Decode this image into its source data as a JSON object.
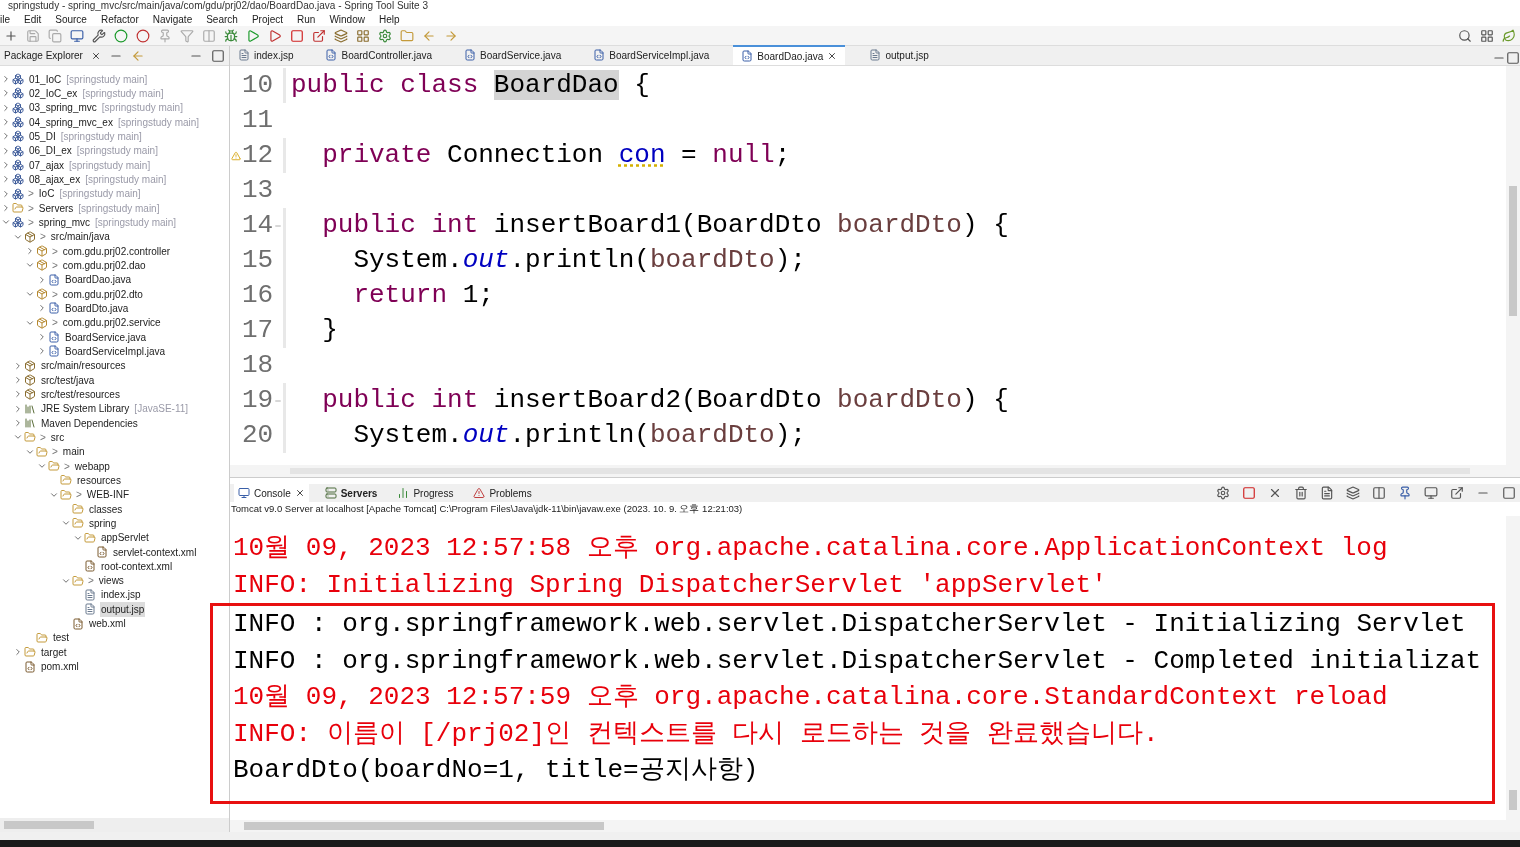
{
  "window": {
    "title": "springstudy - spring_mvc/src/main/java/com/gdu/prj02/dao/BoardDao.java - Spring Tool Suite 3"
  },
  "menu": [
    "ile",
    "Edit",
    "Source",
    "Refactor",
    "Navigate",
    "Search",
    "Project",
    "Run",
    "Window",
    "Help"
  ],
  "package_explorer": {
    "title": "Package Explorer",
    "tree": [
      {
        "label": "01_IoC",
        "decoration": "[springstudy main]",
        "kind": "project",
        "expanded": false,
        "selected": false
      },
      {
        "label": "02_IoC_ex",
        "decoration": "[springstudy main]",
        "kind": "project",
        "expanded": false,
        "selected": false
      },
      {
        "label": "03_spring_mvc",
        "decoration": "[springstudy main]",
        "kind": "project",
        "expanded": false,
        "selected": false
      },
      {
        "label": "04_spring_mvc_ex",
        "decoration": "[springstudy main]",
        "kind": "project",
        "expanded": false,
        "selected": false
      },
      {
        "label": "05_DI",
        "decoration": "[springstudy main]",
        "kind": "project",
        "expanded": false,
        "selected": false
      },
      {
        "label": "06_DI_ex",
        "decoration": "[springstudy main]",
        "kind": "project",
        "expanded": false,
        "selected": false
      },
      {
        "label": "07_ajax",
        "decoration": "[springstudy main]",
        "kind": "project",
        "expanded": false,
        "selected": false
      },
      {
        "label": "08_ajax_ex",
        "decoration": "[springstudy main]",
        "kind": "project",
        "expanded": false,
        "selected": false
      },
      {
        "prefix": ">",
        "label": "IoC",
        "decoration": "[springstudy main]",
        "kind": "project",
        "expanded": false,
        "selected": false
      },
      {
        "prefix": ">",
        "label": "Servers",
        "decoration": "[springstudy main]",
        "kind": "folder",
        "expanded": false,
        "selected": false
      },
      {
        "prefix": ">",
        "label": "spring_mvc",
        "decoration": "[springstudy main]",
        "kind": "project",
        "expanded": true,
        "selected": false,
        "children": [
          {
            "prefix": ">",
            "label": "src/main/java",
            "kind": "source",
            "expanded": true,
            "selected": false,
            "children": [
              {
                "prefix": ">",
                "label": "com.gdu.prj02.controller",
                "kind": "package",
                "expanded": false,
                "selected": false
              },
              {
                "prefix": ">",
                "label": "com.gdu.prj02.dao",
                "kind": "package",
                "expanded": true,
                "selected": false,
                "children": [
                  {
                    "label": "BoardDao.java",
                    "kind": "java",
                    "expanded": false,
                    "selected": false
                  }
                ]
              },
              {
                "prefix": ">",
                "label": "com.gdu.prj02.dto",
                "kind": "package",
                "expanded": true,
                "selected": false,
                "children": [
                  {
                    "label": "BoardDto.java",
                    "kind": "java",
                    "expanded": false,
                    "selected": false
                  }
                ]
              },
              {
                "prefix": ">",
                "label": "com.gdu.prj02.service",
                "kind": "package",
                "expanded": true,
                "selected": false,
                "children": [
                  {
                    "label": "BoardService.java",
                    "kind": "java",
                    "expanded": false,
                    "selected": false
                  },
                  {
                    "label": "BoardServiceImpl.java",
                    "kind": "java",
                    "expanded": false,
                    "selected": false
                  }
                ]
              }
            ]
          },
          {
            "label": "src/main/resources",
            "kind": "source",
            "expanded": false,
            "selected": false
          },
          {
            "label": "src/test/java",
            "kind": "source",
            "expanded": false,
            "selected": false
          },
          {
            "label": "src/test/resources",
            "kind": "source",
            "expanded": false,
            "selected": false
          },
          {
            "label": "JRE System Library",
            "decoration": "[JavaSE-11]",
            "kind": "library",
            "expanded": false,
            "selected": false
          },
          {
            "label": "Maven Dependencies",
            "kind": "library",
            "expanded": false,
            "selected": false
          },
          {
            "prefix": ">",
            "label": "src",
            "kind": "folder",
            "expanded": true,
            "selected": false,
            "children": [
              {
                "prefix": ">",
                "label": "main",
                "kind": "folder",
                "expanded": true,
                "selected": false,
                "children": [
                  {
                    "prefix": ">",
                    "label": "webapp",
                    "kind": "folder",
                    "expanded": true,
                    "selected": false,
                    "children": [
                      {
                        "label": "resources",
                        "kind": "folder",
                        "selected": false
                      },
                      {
                        "prefix": ">",
                        "label": "WEB-INF",
                        "kind": "folder",
                        "expanded": true,
                        "selected": false,
                        "children": [
                          {
                            "label": "classes",
                            "kind": "folder",
                            "selected": false
                          },
                          {
                            "label": "spring",
                            "kind": "folder",
                            "expanded": true,
                            "selected": false,
                            "children": [
                              {
                                "label": "appServlet",
                                "kind": "folder",
                                "expanded": true,
                                "selected": false,
                                "children": [
                                  {
                                    "label": "servlet-context.xml",
                                    "kind": "xml",
                                    "selected": false
                                  }
                                ]
                              },
                              {
                                "label": "root-context.xml",
                                "kind": "xml",
                                "selected": false
                              }
                            ]
                          },
                          {
                            "prefix": ">",
                            "label": "views",
                            "kind": "folder",
                            "expanded": true,
                            "selected": false,
                            "children": [
                              {
                                "label": "index.jsp",
                                "kind": "jsp",
                                "selected": false
                              },
                              {
                                "label": "output.jsp",
                                "kind": "jsp",
                                "selected": true
                              }
                            ]
                          },
                          {
                            "label": "web.xml",
                            "kind": "xml",
                            "selected": false
                          }
                        ]
                      }
                    ]
                  }
                ]
              },
              {
                "label": "test",
                "kind": "folder",
                "selected": false
              }
            ]
          },
          {
            "label": "target",
            "kind": "folder",
            "expanded": false,
            "selected": false
          },
          {
            "label": "pom.xml",
            "kind": "xml",
            "selected": false
          }
        ]
      }
    ]
  },
  "editor": {
    "tabs": [
      {
        "label": "index.jsp",
        "kind": "jsp",
        "selected": false
      },
      {
        "label": "BoardController.java",
        "kind": "java",
        "selected": false
      },
      {
        "label": "BoardService.java",
        "kind": "java",
        "selected": false
      },
      {
        "label": "BoardServiceImpl.java",
        "kind": "java",
        "selected": false
      },
      {
        "label": "BoardDao.java",
        "kind": "java",
        "selected": true
      },
      {
        "label": "output.jsp",
        "kind": "jsp",
        "selected": false
      }
    ],
    "lines": [
      {
        "number": "10",
        "kind": "plain",
        "tokens": [
          {
            "kind": "keyword",
            "text": "public class "
          },
          {
            "kind": "occurrence",
            "text": "BoardDao"
          },
          {
            "kind": "plain",
            "text": " {"
          }
        ]
      },
      {
        "number": "11",
        "kind": "plain"
      },
      {
        "number": "12",
        "kind": "warning",
        "tokens": [
          {
            "kind": "keyword",
            "text": "  private"
          },
          {
            "kind": "plain",
            "text": " Connection "
          },
          {
            "kind": "unused-field",
            "text": "con"
          },
          {
            "kind": "plain",
            "text": " = "
          },
          {
            "kind": "keyword",
            "text": "null"
          },
          {
            "kind": "plain",
            "text": ";"
          }
        ]
      },
      {
        "number": "13",
        "kind": "plain"
      },
      {
        "number": "14",
        "kind": "fold",
        "tokens": [
          {
            "kind": "keyword",
            "text": "  public int"
          },
          {
            "kind": "plain",
            "text": " insertBoard1(BoardDto "
          },
          {
            "kind": "param",
            "text": "boardDto"
          },
          {
            "kind": "plain",
            "text": ") {"
          }
        ]
      },
      {
        "number": "15",
        "kind": "plain",
        "tokens": [
          {
            "kind": "plain",
            "text": "    System."
          },
          {
            "kind": "static",
            "text": "out"
          },
          {
            "kind": "plain",
            "text": ".println("
          },
          {
            "kind": "param",
            "text": "boardDto"
          },
          {
            "kind": "plain",
            "text": ");"
          }
        ]
      },
      {
        "number": "16",
        "kind": "plain",
        "tokens": [
          {
            "kind": "keyword",
            "text": "    return"
          },
          {
            "kind": "plain",
            "text": " 1;"
          }
        ]
      },
      {
        "number": "17",
        "kind": "plain",
        "tokens": [
          {
            "kind": "plain",
            "text": "  }"
          }
        ]
      },
      {
        "number": "18",
        "kind": "plain"
      },
      {
        "number": "19",
        "kind": "fold",
        "tokens": [
          {
            "kind": "keyword",
            "text": "  public int"
          },
          {
            "kind": "plain",
            "text": " insertBoard2(BoardDto "
          },
          {
            "kind": "param",
            "text": "boardDto"
          },
          {
            "kind": "plain",
            "text": ") {"
          }
        ]
      },
      {
        "number": "20",
        "kind": "plain",
        "tokens": [
          {
            "kind": "plain",
            "text": "    System."
          },
          {
            "kind": "static",
            "text": "out"
          },
          {
            "kind": "plain",
            "text": ".println("
          },
          {
            "kind": "param",
            "text": "boardDto"
          },
          {
            "kind": "plain",
            "text": ");"
          }
        ]
      }
    ]
  },
  "console": {
    "tabs": [
      {
        "label": "Console",
        "kind": "console",
        "selected": true,
        "bold": false
      },
      {
        "label": "Servers",
        "kind": "servers",
        "selected": false,
        "bold": true
      },
      {
        "label": "Progress",
        "kind": "progress",
        "selected": false,
        "bold": false
      },
      {
        "label": "Problems",
        "kind": "problems",
        "selected": false,
        "bold": false
      }
    ],
    "description": "Tomcat v9.0 Server at localhost [Apache Tomcat] C:\\Program Files\\Java\\jdk-11\\bin\\javaw.exe  (2023. 10. 9. 오후 12:21:03)",
    "lines": [
      {
        "kind": "err",
        "highlighted": false,
        "text": "10월 09, 2023 12:57:58 오후 org.apache.catalina.core.ApplicationContext log"
      },
      {
        "kind": "err",
        "highlighted": false,
        "text": "INFO: Initializing Spring DispatcherServlet 'appServlet'"
      },
      {
        "kind": "out",
        "highlighted": true,
        "text": "INFO : org.springframework.web.servlet.DispatcherServlet - Initializing Servlet"
      },
      {
        "kind": "out",
        "highlighted": true,
        "text": "INFO : org.springframework.web.servlet.DispatcherServlet - Completed initializat"
      },
      {
        "kind": "err",
        "highlighted": true,
        "text": "10월 09, 2023 12:57:59 오후 org.apache.catalina.core.StandardContext reload"
      },
      {
        "kind": "err",
        "highlighted": true,
        "text": "INFO: 이름이 [/prj02]인 컨텍스트를 다시 로드하는 것을 완료했습니다."
      },
      {
        "kind": "out",
        "highlighted": true,
        "text": "BoardDto(boardNo=1, title=공지사항)"
      }
    ]
  }
}
